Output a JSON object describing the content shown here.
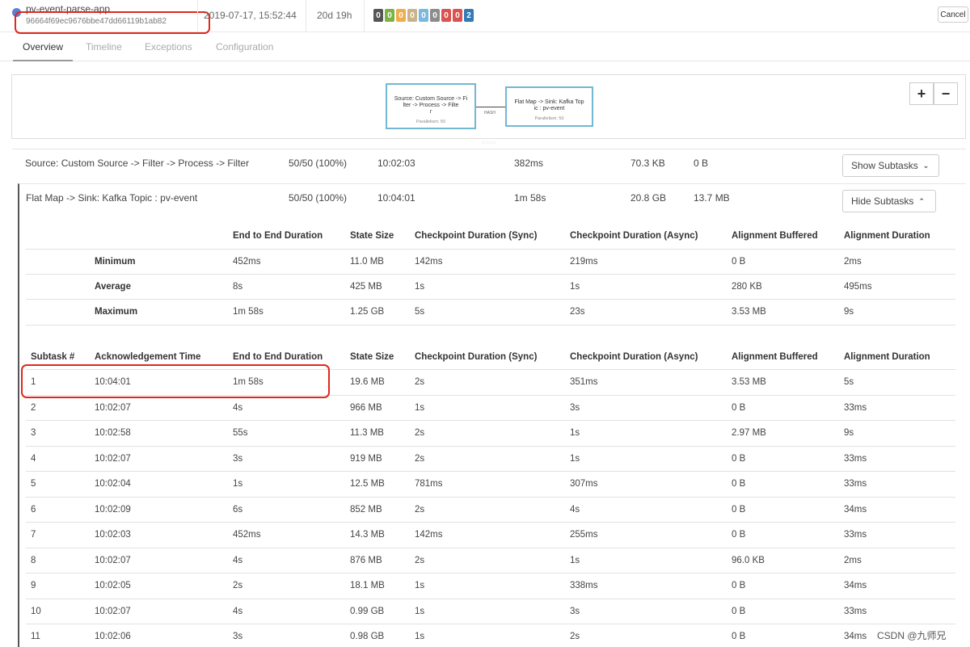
{
  "header": {
    "app_name": "pv-event-parse-app",
    "job_id": "96664f69ec9676bbe47dd66119b1ab82",
    "start_time": "2019-07-17, 15:52:44",
    "duration": "20d 19h",
    "status_counts": [
      {
        "value": "0",
        "color": "#555555"
      },
      {
        "value": "0",
        "color": "#7cb342"
      },
      {
        "value": "0",
        "color": "#f0ad4e"
      },
      {
        "value": "0",
        "color": "#c9b38a"
      },
      {
        "value": "0",
        "color": "#7ab8e0"
      },
      {
        "value": "0",
        "color": "#8c8c8c"
      },
      {
        "value": "0",
        "color": "#d9534f"
      },
      {
        "value": "0",
        "color": "#d9534f"
      },
      {
        "value": "2",
        "color": "#337ab7"
      }
    ],
    "cancel_label": "Cancel"
  },
  "tabs": [
    {
      "label": "Overview",
      "active": true
    },
    {
      "label": "Timeline",
      "active": false
    },
    {
      "label": "Exceptions",
      "active": false
    },
    {
      "label": "Configuration",
      "active": false
    }
  ],
  "plan": {
    "node1": {
      "line1": "Source: Custom Source -> Fi",
      "line2": "lter -> Process -> Filte",
      "line3": "r",
      "parallelism": "Parallelism: 50"
    },
    "node2": {
      "line1": "Flat Map -> Sink: Kafka Top",
      "line2": "ic : pv-event",
      "parallelism": "Parallelism: 50"
    },
    "edge_label": "HASH",
    "zoom_in": "+",
    "zoom_out": "−"
  },
  "operators": [
    {
      "name": "Source: Custom Source -> Filter -> Process -> Filter",
      "acknowledged": "50/50 (100%)",
      "latest_ack": "10:02:03",
      "duration": "382ms",
      "state_size": "70.3 KB",
      "buffered": "0 B",
      "button": "Show Subtasks"
    },
    {
      "name": "Flat Map -> Sink: Kafka Topic : pv-event",
      "acknowledged": "50/50 (100%)",
      "latest_ack": "10:04:01",
      "duration": "1m 58s",
      "state_size": "20.8 GB",
      "buffered": "13.7 MB",
      "button": "Hide Subtasks"
    }
  ],
  "summary": {
    "headers": [
      "End to End Duration",
      "State Size",
      "Checkpoint Duration (Sync)",
      "Checkpoint Duration (Async)",
      "Alignment Buffered",
      "Alignment Duration"
    ],
    "rows": [
      {
        "label": "Minimum",
        "values": [
          "452ms",
          "11.0 MB",
          "142ms",
          "219ms",
          "0 B",
          "2ms"
        ]
      },
      {
        "label": "Average",
        "values": [
          "8s",
          "425 MB",
          "1s",
          "1s",
          "280 KB",
          "495ms"
        ]
      },
      {
        "label": "Maximum",
        "values": [
          "1m 58s",
          "1.25 GB",
          "5s",
          "23s",
          "3.53 MB",
          "9s"
        ]
      }
    ]
  },
  "subtasks": {
    "headers": [
      "Subtask #",
      "Acknowledgement Time",
      "End to End Duration",
      "State Size",
      "Checkpoint Duration (Sync)",
      "Checkpoint Duration (Async)",
      "Alignment Buffered",
      "Alignment Duration"
    ],
    "rows": [
      [
        "1",
        "10:04:01",
        "1m 58s",
        "19.6 MB",
        "2s",
        "351ms",
        "3.53 MB",
        "5s"
      ],
      [
        "2",
        "10:02:07",
        "4s",
        "966 MB",
        "1s",
        "3s",
        "0 B",
        "33ms"
      ],
      [
        "3",
        "10:02:58",
        "55s",
        "11.3 MB",
        "2s",
        "1s",
        "2.97 MB",
        "9s"
      ],
      [
        "4",
        "10:02:07",
        "3s",
        "919 MB",
        "2s",
        "1s",
        "0 B",
        "33ms"
      ],
      [
        "5",
        "10:02:04",
        "1s",
        "12.5 MB",
        "781ms",
        "307ms",
        "0 B",
        "33ms"
      ],
      [
        "6",
        "10:02:09",
        "6s",
        "852 MB",
        "2s",
        "4s",
        "0 B",
        "34ms"
      ],
      [
        "7",
        "10:02:03",
        "452ms",
        "14.3 MB",
        "142ms",
        "255ms",
        "0 B",
        "33ms"
      ],
      [
        "8",
        "10:02:07",
        "4s",
        "876 MB",
        "2s",
        "1s",
        "96.0 KB",
        "2ms"
      ],
      [
        "9",
        "10:02:05",
        "2s",
        "18.1 MB",
        "1s",
        "338ms",
        "0 B",
        "34ms"
      ],
      [
        "10",
        "10:02:07",
        "4s",
        "0.99 GB",
        "1s",
        "3s",
        "0 B",
        "33ms"
      ],
      [
        "11",
        "10:02:06",
        "3s",
        "0.98 GB",
        "1s",
        "2s",
        "0 B",
        "34ms"
      ]
    ]
  },
  "watermark": "CSDN @九师兄"
}
